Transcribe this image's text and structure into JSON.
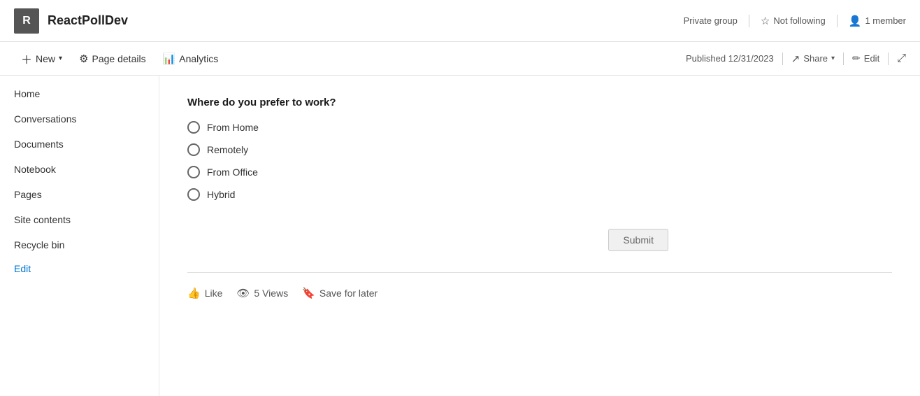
{
  "header": {
    "avatar_letter": "R",
    "site_title": "ReactPollDev",
    "group_type": "Private group",
    "following_label": "Not following",
    "members_label": "1 member"
  },
  "toolbar": {
    "new_label": "New",
    "page_details_label": "Page details",
    "analytics_label": "Analytics",
    "published_label": "Published 12/31/2023",
    "share_label": "Share",
    "edit_label": "Edit"
  },
  "sidebar": {
    "items": [
      {
        "label": "Home",
        "id": "home"
      },
      {
        "label": "Conversations",
        "id": "conversations"
      },
      {
        "label": "Documents",
        "id": "documents"
      },
      {
        "label": "Notebook",
        "id": "notebook"
      },
      {
        "label": "Pages",
        "id": "pages"
      },
      {
        "label": "Site contents",
        "id": "site-contents"
      },
      {
        "label": "Recycle bin",
        "id": "recycle-bin"
      }
    ],
    "edit_label": "Edit"
  },
  "poll": {
    "question": "Where do you prefer to work?",
    "options": [
      {
        "label": "From Home",
        "id": "from-home"
      },
      {
        "label": "Remotely",
        "id": "remotely"
      },
      {
        "label": "From Office",
        "id": "from-office"
      },
      {
        "label": "Hybrid",
        "id": "hybrid"
      }
    ],
    "submit_label": "Submit"
  },
  "footer": {
    "like_label": "Like",
    "views_label": "5 Views",
    "save_label": "Save for later"
  }
}
